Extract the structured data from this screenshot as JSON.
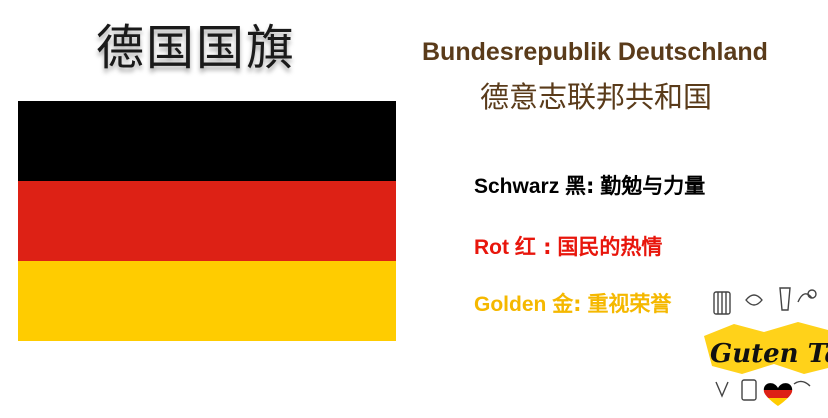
{
  "title": "德国国旗",
  "official_name": {
    "german": "Bundesrepublik Deutschland",
    "chinese": "德意志联邦共和国"
  },
  "flag": {
    "stripes": [
      {
        "name": "black",
        "color": "#000000"
      },
      {
        "name": "red",
        "color": "#dd2115"
      },
      {
        "name": "gold",
        "color": "#ffcc00"
      }
    ]
  },
  "meanings": [
    {
      "label": "Schwarz",
      "zh": "黑:",
      "meaning": "勤勉与力量",
      "color": "#000000"
    },
    {
      "label": "Rot",
      "zh": "红 :",
      "meaning": "国民的热情",
      "color": "#e8160c"
    },
    {
      "label": "Golden",
      "zh": "金:",
      "meaning": "重视荣誉",
      "color": "#f5b800"
    }
  ],
  "badge": {
    "text": "Guten Tag",
    "icon": "heart-flag-icon"
  }
}
